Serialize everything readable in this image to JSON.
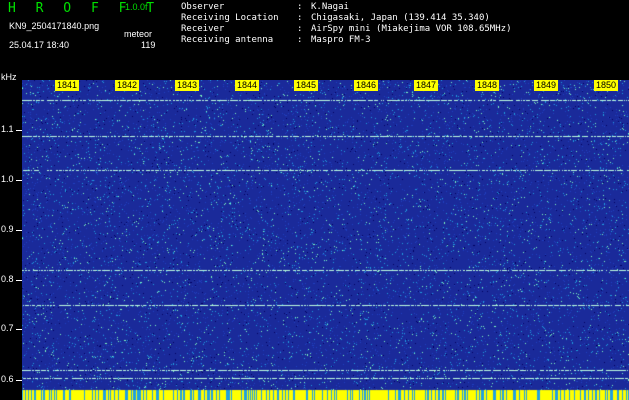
{
  "header": {
    "app_title": "H R O F F T",
    "version": "1.0.0f",
    "file_name": "KN9_2504171840.png",
    "meteor_label": "meteor",
    "timestamp": "25.04.17 18:40",
    "meteor_count": "119",
    "meta": [
      {
        "key": "Observer",
        "sep": ":",
        "value": "K.Nagai"
      },
      {
        "key": "Receiving Location",
        "sep": ":",
        "value": "Chigasaki, Japan (139.414 35.340)"
      },
      {
        "key": "Receiver",
        "sep": ":",
        "value": "AirSpy mini (Miakejima VOR 108.65MHz)"
      },
      {
        "key": "Receiving antenna",
        "sep": ":",
        "value": "Maspro FM-3"
      }
    ]
  },
  "spectrogram": {
    "unit": "kHz",
    "y_ticks": [
      "1.1",
      "1.0",
      "0.9",
      "0.8",
      "0.7",
      "0.6"
    ],
    "x_ticks": [
      "1841",
      "1842",
      "1843",
      "1844",
      "1845",
      "1846",
      "1847",
      "1848",
      "1849",
      "1850"
    ],
    "colors": {
      "background": "#1a2a9a",
      "noise_low": "#2040c0",
      "noise_mid": "#20a0e0",
      "noise_high": "#80ffc0",
      "carrier": "#c0ffe0",
      "baseline": "#ffff00"
    }
  }
}
